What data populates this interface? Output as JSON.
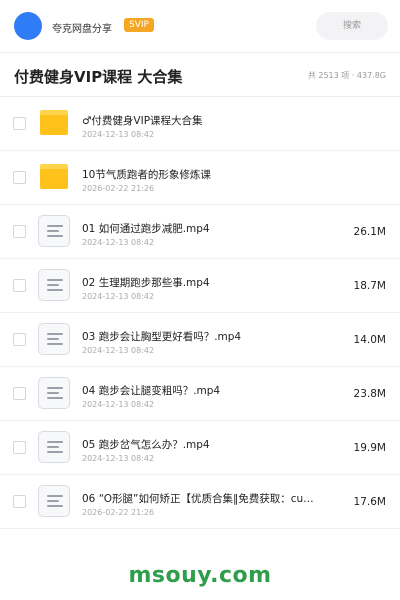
{
  "header": {
    "user_name": "夸克网盘分享",
    "badge": "SVIP",
    "search_label": "搜索"
  },
  "title_bar": {
    "title": "付费健身VIP课程 大合集",
    "meta": "共 2513 项 · 437.8G"
  },
  "items": [
    {
      "type": "folder",
      "name": "♂付费健身VIP课程大合集",
      "date": "2024-12-13 08:42",
      "size": ""
    },
    {
      "type": "folder",
      "name": "10节气质跑者的形象修炼课",
      "date": "2026-02-22 21:26",
      "size": ""
    },
    {
      "type": "file",
      "name": "01  如何通过跑步减肥.mp4",
      "date": "2024-12-13 08:42",
      "size": "26.1M"
    },
    {
      "type": "file",
      "name": "02  生理期跑步那些事.mp4",
      "date": "2024-12-13 08:42",
      "size": "18.7M"
    },
    {
      "type": "file",
      "name": "03  跑步会让胸型更好看吗？.mp4",
      "date": "2024-12-13 08:42",
      "size": "14.0M"
    },
    {
      "type": "file",
      "name": "04  跑步会让腿变粗吗？.mp4",
      "date": "2024-12-13 08:42",
      "size": "23.8M"
    },
    {
      "type": "file",
      "name": "05  跑步岔气怎么办？.mp4",
      "date": "2024-12-13 08:42",
      "size": "19.9M"
    },
    {
      "type": "file",
      "name": "06 “O形腿”如何矫正【优质合集‖免费获取：cu…",
      "date": "2026-02-22 21:26",
      "size": "17.6M"
    }
  ],
  "watermark": "msouy.com",
  "colors": {
    "accent": "#2f7cf6",
    "badge": "#f5a623",
    "folder": "#ffc21a",
    "watermark": "#2e9e4a"
  }
}
